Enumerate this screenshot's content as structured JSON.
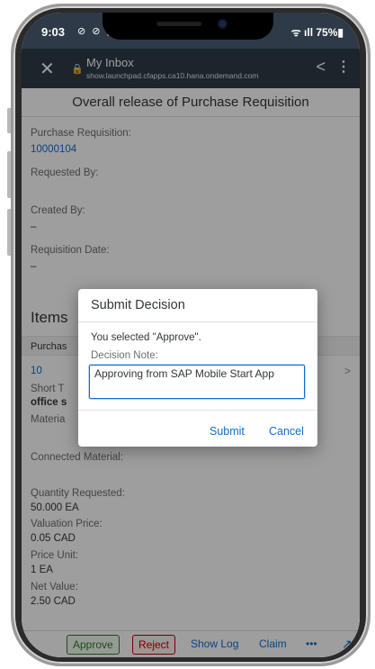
{
  "status_bar": {
    "time": "9:03",
    "indicators": "⊘ ⊘ ▣",
    "signal_battery": "ᯤ ıll 75%▮"
  },
  "browser": {
    "close_glyph": "✕",
    "lock_glyph": "🔒",
    "title": "My Inbox",
    "host": "show.launchpad.cfapps.ca10.hana.ondemand.com",
    "share_glyph": "<",
    "more_glyph": "⋮"
  },
  "page": {
    "title": "Overall release of Purchase Requisition",
    "fields": {
      "purchase_requisition_label": "Purchase Requisition:",
      "purchase_requisition_value": "10000104",
      "requested_by_label": "Requested By:",
      "created_by_label": "Created By:",
      "created_by_value": "–",
      "requisition_date_label": "Requisition Date:",
      "requisition_date_value": "–"
    },
    "items": {
      "title": "Items",
      "column_header": "Purchas",
      "row_number": "10",
      "short_text_label": "Short T",
      "short_text_value": "office s",
      "material_label": "Materia",
      "connected_material_label": "Connected Material:",
      "quantity_requested_label": "Quantity Requested:",
      "quantity_requested_value": "50.000 EA",
      "valuation_price_label": "Valuation Price:",
      "valuation_price_value": "0.05  CAD",
      "price_unit_label": "Price Unit:",
      "price_unit_value": "1 EA",
      "net_value_label": "Net Value:",
      "net_value_value": "2.50  CAD",
      "row_chevron": ">"
    }
  },
  "dialog": {
    "title": "Submit Decision",
    "message": "You selected \"Approve\".",
    "note_label": "Decision Note:",
    "note_value": "Approving from SAP Mobile Start App",
    "submit_label": "Submit",
    "cancel_label": "Cancel"
  },
  "toolbar": {
    "approve_label": "Approve",
    "reject_label": "Reject",
    "show_log_label": "Show Log",
    "claim_label": "Claim",
    "more_label": "•••",
    "open_label": "↗"
  }
}
